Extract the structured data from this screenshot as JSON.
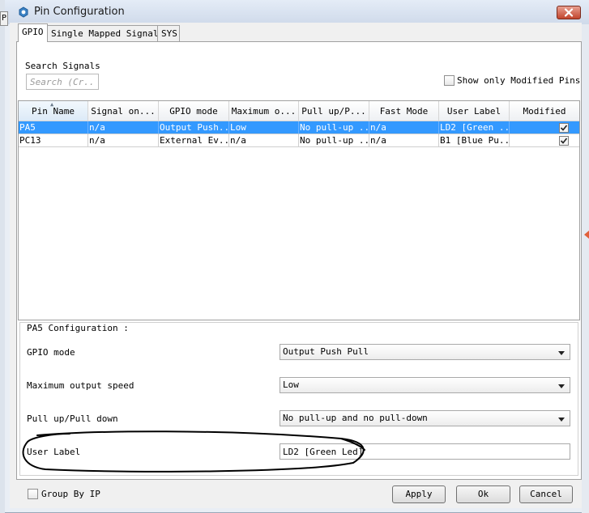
{
  "window": {
    "title": "Pin Configuration",
    "left_fragment": "P"
  },
  "tabs": [
    {
      "label": "GPIO",
      "active": true
    },
    {
      "label": "Single Mapped Signals",
      "active": false
    },
    {
      "label": "SYS",
      "active": false
    }
  ],
  "search": {
    "label": "Search Signals",
    "placeholder": "Search (Cr..."
  },
  "show_modified": {
    "label": "Show only Modified Pins",
    "checked": false
  },
  "table": {
    "columns": [
      "Pin Name",
      "Signal on...",
      "GPIO mode",
      "Maximum o...",
      "Pull up/P...",
      "Fast Mode",
      "User Label",
      "Modified"
    ],
    "rows": [
      {
        "pin": "PA5",
        "signal": "n/a",
        "mode": "Output Push...",
        "speed": "Low",
        "pull": "No pull-up ...",
        "fast": "n/a",
        "label": "LD2 [Green ...",
        "modified": true,
        "selected": true
      },
      {
        "pin": "PC13",
        "signal": "n/a",
        "mode": "External Ev...",
        "speed": "n/a",
        "pull": "No pull-up ...",
        "fast": "n/a",
        "label": "B1 [Blue Pu...",
        "modified": true,
        "selected": false
      }
    ]
  },
  "config": {
    "title": "PA5 Configuration :",
    "gpio_mode": {
      "label": "GPIO mode",
      "value": "Output Push Pull"
    },
    "max_speed": {
      "label": "Maximum output speed",
      "value": "Low"
    },
    "pull": {
      "label": "Pull up/Pull down",
      "value": "No pull-up and no pull-down"
    },
    "user_label": {
      "label": "User Label",
      "value": "LD2 [Green Led]"
    }
  },
  "group_by_ip": {
    "label": "Group By IP",
    "checked": false
  },
  "buttons": {
    "apply": "Apply",
    "ok": "Ok",
    "cancel": "Cancel"
  },
  "colors": {
    "selection": "#3399ff",
    "annotation": "#000000",
    "close_button": "#c2452d"
  }
}
